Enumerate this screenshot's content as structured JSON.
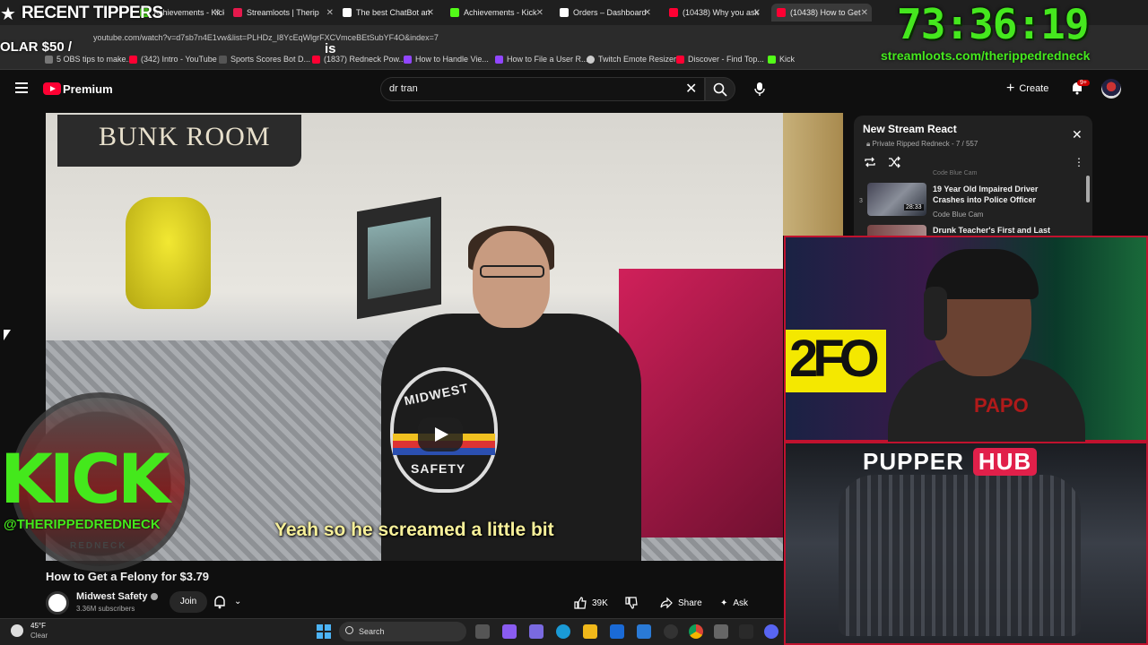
{
  "browser": {
    "tabs": [
      {
        "label": "Achievements - Kick",
        "color": "#53fc18"
      },
      {
        "label": "Streamloots | Therip",
        "color": "#e5194c"
      },
      {
        "label": "The best ChatBot an",
        "color": "#ffffff"
      },
      {
        "label": "Achievements - Kick",
        "color": "#53fc18"
      },
      {
        "label": "Orders – Dashboard",
        "color": "#ffffff"
      },
      {
        "label": "(10438) Why you ask",
        "color": "#ff0033"
      },
      {
        "label": "(10438) How to Get",
        "color": "#ff0033"
      }
    ],
    "url": "youtube.com/watch?v=d7sb7n4E1vw&list=PLHDz_I8YcEqWlgrFXCVmceBEtSubYF4O&index=7",
    "bookmarks": [
      {
        "label": "5 OBS tips to make...",
        "color": "#777777"
      },
      {
        "label": "(342) Intro - YouTube",
        "color": "#ff0033"
      },
      {
        "label": "Sports Scores Bot D...",
        "color": "#555555"
      },
      {
        "label": "(1837) Redneck Pow...",
        "color": "#ff0033"
      },
      {
        "label": "How to Handle Vie...",
        "color": "#9146ff"
      },
      {
        "label": "How to File a User R...",
        "color": "#9146ff"
      },
      {
        "label": "Twitch Emote Resizer",
        "color": "#cccccc"
      },
      {
        "label": "Discover - Find Top...",
        "color": "#ff0033"
      },
      {
        "label": "Kick",
        "color": "#53fc18"
      }
    ]
  },
  "youtube": {
    "logo_text": "Premium",
    "search_value": "dr tran",
    "create_label": "Create",
    "notif_count": "9+"
  },
  "video": {
    "subtitle": "Yeah so he screamed a little bit",
    "scene_sign": "BUNK ROOM",
    "badge_top": "MIDWEST",
    "badge_bottom": "SAFETY",
    "title": "How to Get a Felony for $3.79",
    "channel": "Midwest Safety",
    "subscribers": "3.36M subscribers",
    "join_label": "Join",
    "likes": "39K",
    "share_label": "Share",
    "ask_label": "Ask"
  },
  "playlist": {
    "title": "New Stream React",
    "subtitle": "Private Ripped Redneck - 7 / 557",
    "top_channel": "Code Blue Cam",
    "items": [
      {
        "index": "3",
        "title": "19 Year Old Impaired Driver Crashes into Police Officer",
        "channel": "Code Blue Cam",
        "duration": "28:33"
      },
      {
        "title": "Drunk Teacher's First and Last"
      }
    ]
  },
  "overlay": {
    "tippers": "RECENT TIPPERS",
    "solar": "OLAR $50 /",
    "is_text": "is",
    "timer": "73:36:19",
    "streamloots_url": "streamloots.com/therippedredneck",
    "kick_text": "KICK",
    "kick_handle": "@THERIPPEDREDNECK",
    "kick_sub": "REDNECK",
    "cam_yellow": "2FO",
    "cam_shirt": "PAPO",
    "pupper_title": "PUPPER",
    "pupper_hub": "HUB"
  },
  "taskbar": {
    "temperature": "45°F",
    "condition": "Clear",
    "search_label": "Search"
  }
}
